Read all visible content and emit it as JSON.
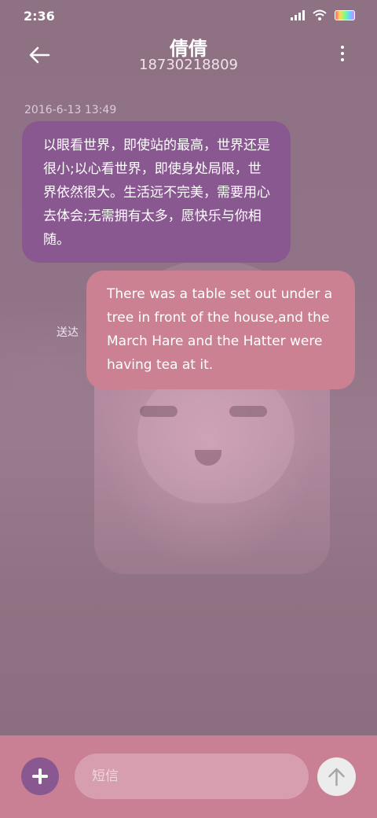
{
  "status_bar": {
    "time": "2:36",
    "icons": [
      "signal-icon",
      "wifi-icon",
      "battery-icon"
    ]
  },
  "header": {
    "contact_name": "倩倩",
    "phone_number": "18730218809",
    "back_icon": "arrow-left-icon",
    "menu_icon": "more-vertical-icon"
  },
  "conversation": {
    "timestamp": "2016-6-13 13:49",
    "messages": [
      {
        "direction": "incoming",
        "text": "以眼看世界，即使站的最高，世界还是很小;以心看世界，即使身处局限，世界依然很大。生活远不完美，需要用心去体会;无需拥有太多，愿快乐与你相随。"
      },
      {
        "direction": "outgoing",
        "text": "There was a table set out under a tree in front of the house,and the March Hare and the Hatter were having tea at it.",
        "status": "送达"
      }
    ]
  },
  "composer": {
    "placeholder": "短信",
    "value": "",
    "add_icon": "plus-icon",
    "send_icon": "arrow-up-icon"
  },
  "colors": {
    "background": "#8e7283",
    "incoming_bubble": "#8a5891",
    "outgoing_bubble": "#cc8193",
    "bottom_bar": "#c97f94",
    "input_fill": "#d69eae",
    "send_button": "#ececec"
  }
}
